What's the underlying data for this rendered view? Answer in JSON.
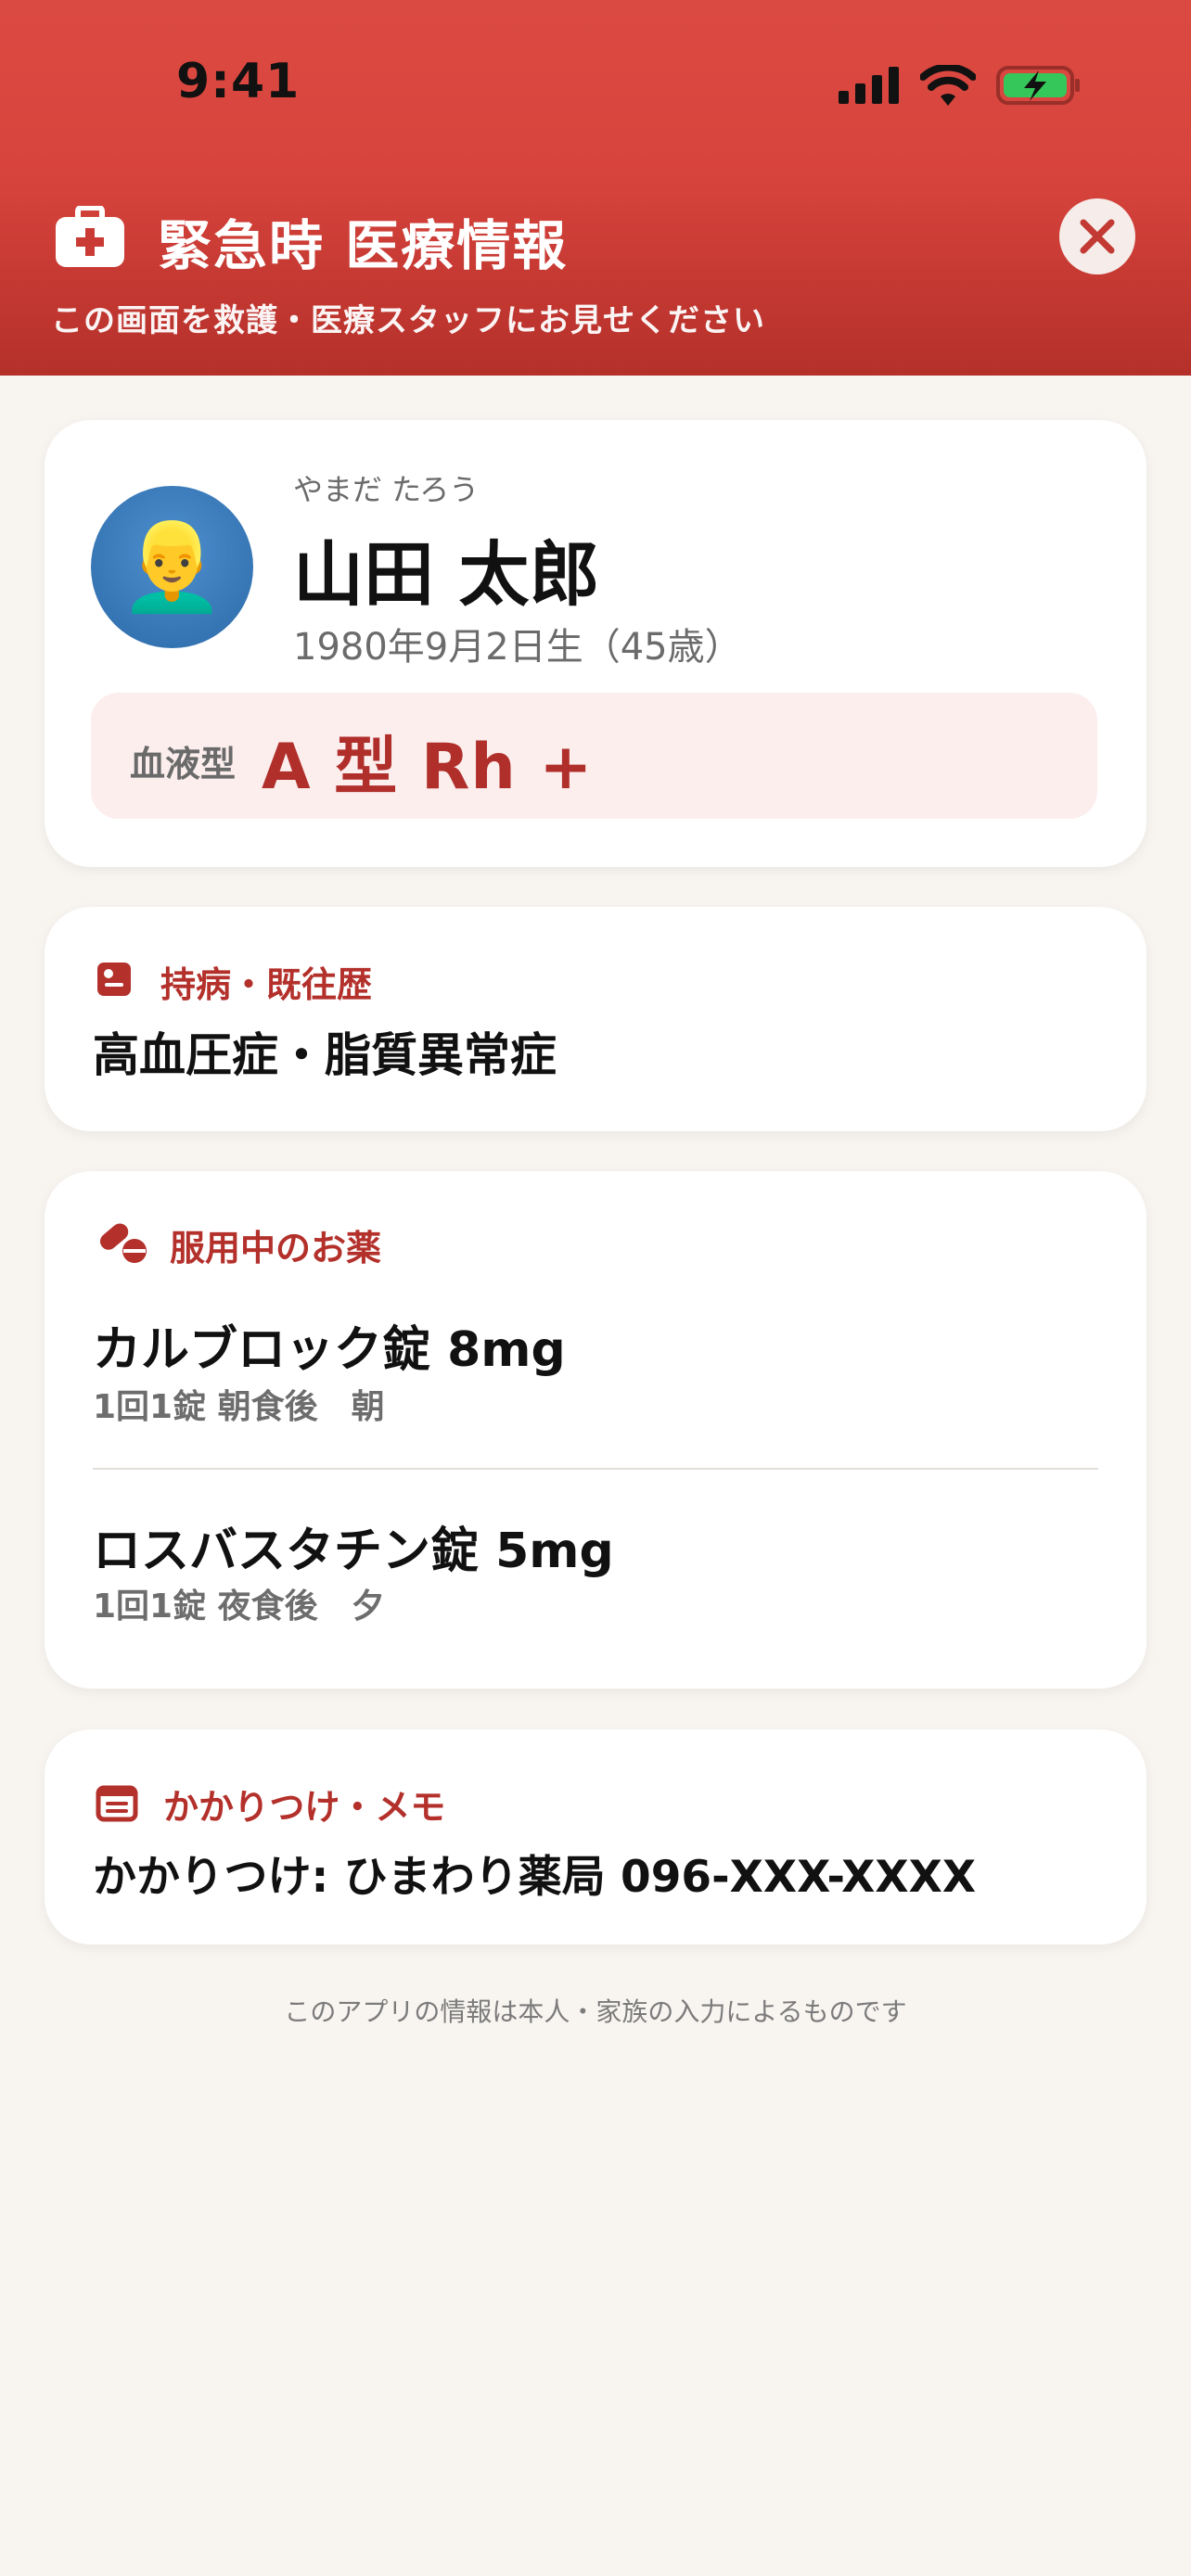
{
  "status_bar": {
    "time": "9:41"
  },
  "header": {
    "title": "緊急時 医療情報",
    "subtitle": "この画面を救護・医療スタッフにお見せください",
    "icon": "medical-kit-icon",
    "close_icon": "close-icon"
  },
  "profile": {
    "avatar": "👱‍♂️",
    "kana": "やまだ たろう",
    "name": "山田 太郎",
    "birth": "1980年9月2日生（45歳）",
    "blood_label": "血液型",
    "blood_value": "A 型 Rh +"
  },
  "conditions": {
    "title": "持病・既往歴",
    "icon": "medical-record-icon",
    "text": "高血圧症・脂質異常症"
  },
  "medications": {
    "title": "服用中のお薬",
    "icon": "pills-icon",
    "items": [
      {
        "name": "カルブロック錠 8mg",
        "dose": "1回1錠 朝食後　朝"
      },
      {
        "name": "ロスバスタチン錠 5mg",
        "dose": "1回1錠 夜食後　夕"
      }
    ]
  },
  "memo": {
    "title": "かかりつけ・メモ",
    "icon": "memo-icon",
    "text": "かかりつけ: ひまわり薬局 096-XXX-XXXX"
  },
  "footer": {
    "note": "このアプリの情報は本人・家族の入力によるものです"
  },
  "colors": {
    "accent": "#b3302b",
    "header_top": "#db4a42",
    "header_bottom": "#b5302a",
    "background": "#f8f5f1"
  }
}
